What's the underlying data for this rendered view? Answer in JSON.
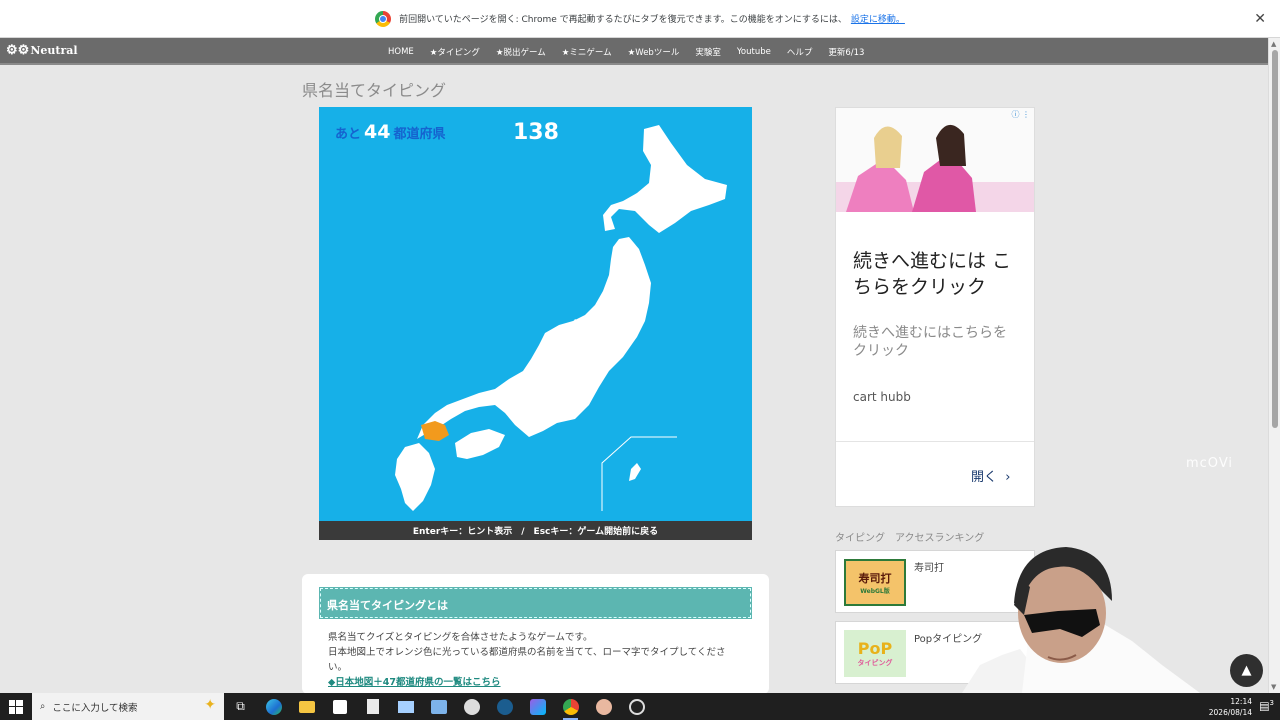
{
  "infobar": {
    "message": "前回開いていたページを開く: Chrome で再起動するたびにタブを復元できます。この機能をオンにするには、",
    "link": "設定に移動。",
    "close": "✕"
  },
  "header": {
    "logo": "Neutral",
    "nav": [
      "HOME",
      "★タイピング",
      "★脱出ゲーム",
      "★ミニゲーム",
      "★Webツール",
      "実験室",
      "Youtube",
      "ヘルプ",
      "更新6/13"
    ]
  },
  "page": {
    "title": "県名当てタイピング"
  },
  "game": {
    "remaining_prefix": "あと",
    "remaining_count": "44",
    "remaining_suffix": "都道府県",
    "score": "138",
    "hint": "Enterキー：ヒント表示　/　Escキー：ゲーム開始前に戻る",
    "colors": {
      "sea": "#16b0e8",
      "land": "#ffffff",
      "highlight": "#f29a1d"
    }
  },
  "ad": {
    "headline": "続きへ進むには こちらをクリック",
    "description": "続きへ進むにはこちらを クリック",
    "brand": "cart hubb",
    "open_label": "開く",
    "info_icon": "ⓘ ⋮"
  },
  "watermark": "mcOVi",
  "ranking": {
    "title": "タイピング　アクセスランキング",
    "items": [
      {
        "name": "寿司打",
        "thumb_text": "寿司打",
        "thumb_sub": "WebGL版"
      },
      {
        "name": "Popタイピング",
        "thumb_text": "PoP",
        "thumb_sub": "タイピング"
      }
    ]
  },
  "description": {
    "heading": "県名当てタイピングとは",
    "text": "県名当てクイズとタイピングを合体させたようなゲームです。\n日本地図上でオレンジ色に光っている都道府県の名前を当てて、ローマ字でタイプしてください。",
    "link": "◆日本地図＋47都道府県の一覧はこちら"
  },
  "taskbar": {
    "search_placeholder": "ここに入力して検索",
    "time": "12:14",
    "date": "2026/08/14",
    "notification_count": "3"
  }
}
